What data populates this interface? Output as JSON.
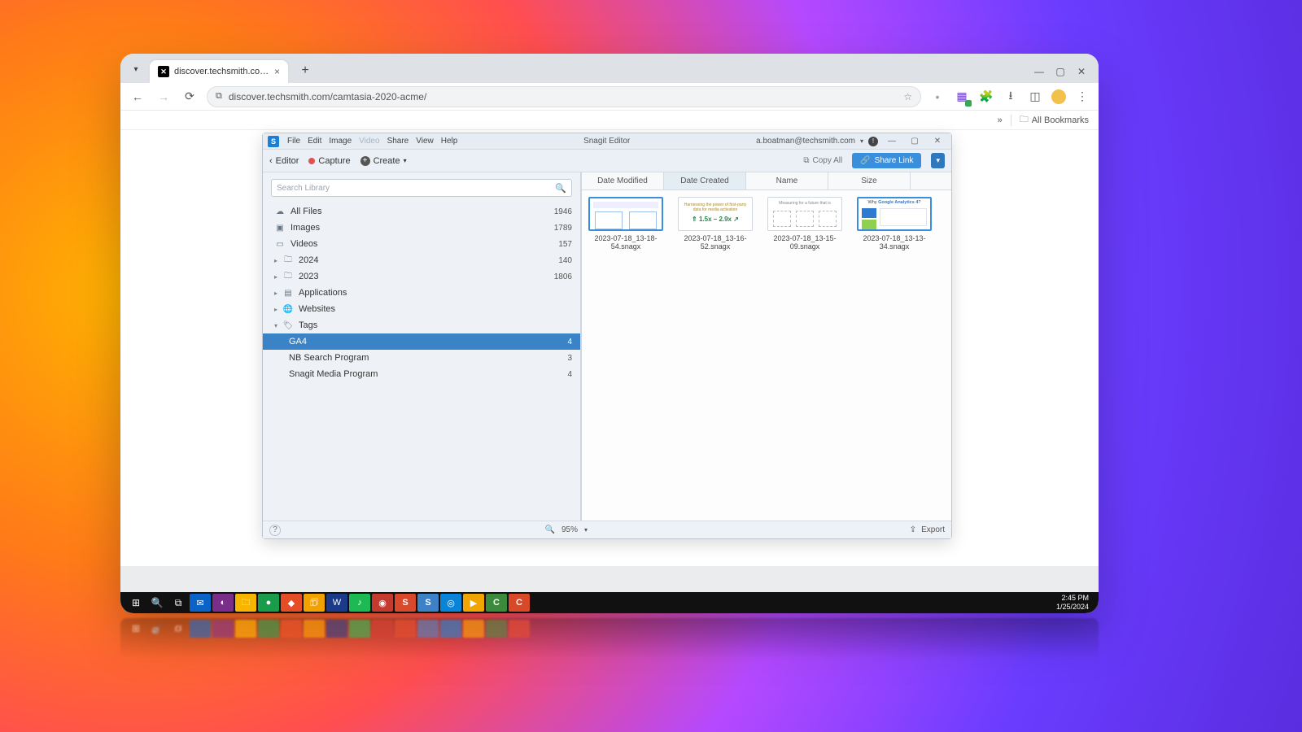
{
  "browser": {
    "tab_title": "discover.techsmith.com/camta…",
    "url": "discover.techsmith.com/camtasia-2020-acme/",
    "bookmarks_label": "All Bookmarks",
    "chevrons": "»"
  },
  "snagit": {
    "title": "Snagit Editor",
    "user_email": "a.boatman@techsmith.com",
    "menu": {
      "file": "File",
      "edit": "Edit",
      "image": "Image",
      "video": "Video",
      "share": "Share",
      "view": "View",
      "help": "Help"
    },
    "toolbar": {
      "back": "‹",
      "editor": "Editor",
      "capture": "Capture",
      "create": "Create",
      "create_caret": "▾",
      "copy_all": "Copy All",
      "share_link": "Share Link"
    },
    "search_placeholder": "Search Library",
    "tree": {
      "all_files": {
        "label": "All Files",
        "count": "1946"
      },
      "images": {
        "label": "Images",
        "count": "1789"
      },
      "videos": {
        "label": "Videos",
        "count": "157"
      },
      "y2024": {
        "label": "2024",
        "count": "140"
      },
      "y2023": {
        "label": "2023",
        "count": "1806"
      },
      "applications": {
        "label": "Applications"
      },
      "websites": {
        "label": "Websites"
      },
      "tags": {
        "label": "Tags"
      },
      "tag_ga4": {
        "label": "GA4",
        "count": "4"
      },
      "tag_nb": {
        "label": "NB Search Program",
        "count": "3"
      },
      "tag_snagit": {
        "label": "Snagit Media Program",
        "count": "4"
      }
    },
    "sort_tabs": {
      "modified": "Date Modified",
      "created": "Date Created",
      "name": "Name",
      "size": "Size"
    },
    "items": {
      "i1": "2023-07-18_13-18-54.snagx",
      "i2": "2023-07-18_13-16-52.snagx",
      "i3": "2023-07-18_13-15-09.snagx",
      "i4": "2023-07-18_13-13-34.snagx"
    },
    "status": {
      "zoom_label": "95%",
      "export": "Export"
    }
  },
  "taskbar": {
    "time": "2:45 PM",
    "date": "1/25/2024"
  }
}
